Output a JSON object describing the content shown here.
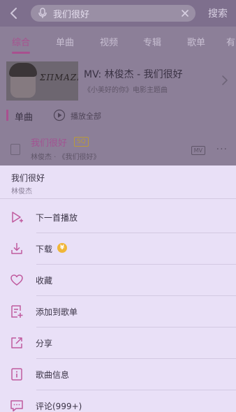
{
  "search": {
    "query": "我们很好",
    "button_label": "搜索"
  },
  "tabs": [
    {
      "label": "综合",
      "active": true
    },
    {
      "label": "单曲"
    },
    {
      "label": "视频"
    },
    {
      "label": "专辑"
    },
    {
      "label": "歌单"
    },
    {
      "label": "有"
    }
  ],
  "mv": {
    "title": "MV: 林俊杰 - 我们很好",
    "subtitle": "《小美好的你》电影主题曲",
    "thumb_script": "ΣΠΜΑΖΕΤ"
  },
  "singles": {
    "header": "单曲",
    "play_all_label": "播放全部"
  },
  "song": {
    "name": "我们很好",
    "quality_badge": "SQ",
    "meta": "林俊杰 · 《我们很好》",
    "mv_badge": "MV",
    "more": "···"
  },
  "sheet": {
    "song_title": "我们很好",
    "artist": "林俊杰",
    "menu": [
      {
        "label": "下一首播放",
        "icon": "play-next-icon"
      },
      {
        "label": "下载",
        "icon": "download-icon",
        "badge": "¥"
      },
      {
        "label": "收藏",
        "icon": "heart-icon"
      },
      {
        "label": "添加到歌单",
        "icon": "add-to-playlist-icon"
      },
      {
        "label": "分享",
        "icon": "share-icon"
      },
      {
        "label": "歌曲信息",
        "icon": "info-icon"
      },
      {
        "label": "评论(999+)",
        "icon": "comment-icon"
      }
    ]
  },
  "colors": {
    "accent": "#a9508f",
    "sheet_bg": "#e9e0f7",
    "icon": "#c05a9e",
    "vip": "#f0b638"
  }
}
